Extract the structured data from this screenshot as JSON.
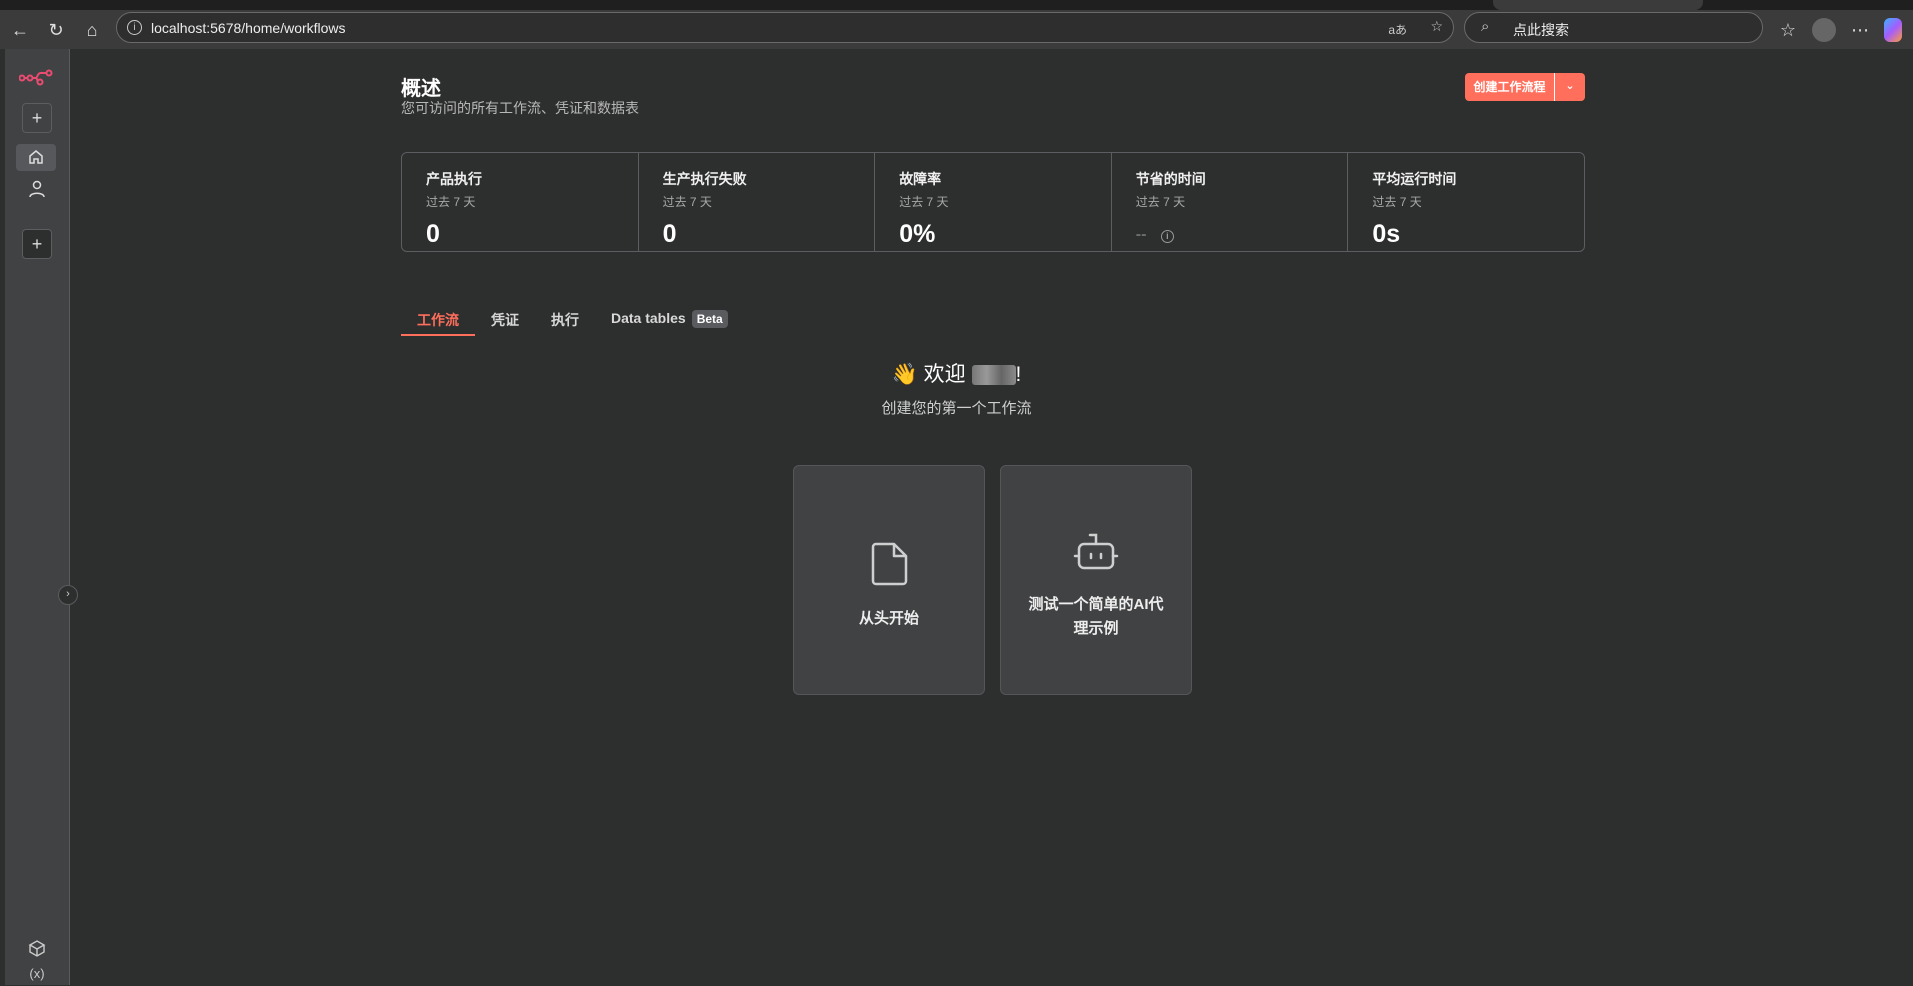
{
  "browser": {
    "url": "localhost:5678/home/workflows",
    "search_placeholder": "点此搜索",
    "translate_icon_label": "aあ"
  },
  "header": {
    "title": "概述",
    "subtitle": "您可访问的所有工作流、凭证和数据表",
    "create_button": "创建工作流程"
  },
  "stats": [
    {
      "label": "产品执行",
      "period": "过去 7 天",
      "value": "0"
    },
    {
      "label": "生产执行失败",
      "period": "过去 7 天",
      "value": "0"
    },
    {
      "label": "故障率",
      "period": "过去 7 天",
      "value": "0%"
    },
    {
      "label": "节省的时间",
      "period": "过去 7 天",
      "value": "--"
    },
    {
      "label": "平均运行时间",
      "period": "过去 7 天",
      "value": "0s"
    }
  ],
  "tabs": [
    {
      "label": "工作流"
    },
    {
      "label": "凭证"
    },
    {
      "label": "执行"
    },
    {
      "label": "Data tables",
      "badge": "Beta"
    }
  ],
  "welcome": {
    "emoji": "👋",
    "text": "欢迎",
    "exclaim": "!",
    "subtitle": "创建您的第一个工作流"
  },
  "cards": [
    {
      "label": "从头开始"
    },
    {
      "label": "测试一个简单的AI代理示例"
    }
  ],
  "colors": {
    "accent": "#ff6f5c",
    "background": "#2d2e2e",
    "sidebar": "#414244"
  }
}
